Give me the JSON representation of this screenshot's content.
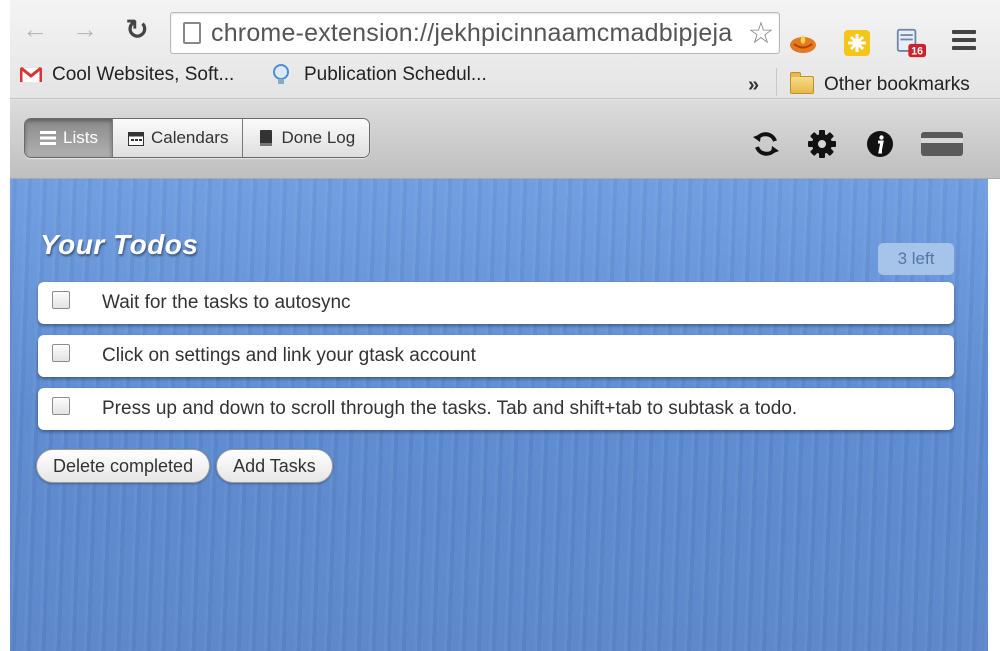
{
  "browser": {
    "url": "chrome-extension://jekhpicinnaamcmadbipjeja",
    "bookmarks": [
      {
        "label": "Cool Websites, Soft...",
        "icon": "gmail-icon"
      },
      {
        "label": "Publication Schedul...",
        "icon": "lightbulb-icon"
      }
    ],
    "more_label": "»",
    "other_bookmarks": "Other bookmarks",
    "extension_badge": "16"
  },
  "toolbar": {
    "tabs": [
      {
        "label": "Lists",
        "icon": "list-icon",
        "active": true
      },
      {
        "label": "Calendars",
        "icon": "calendar-icon",
        "active": false
      },
      {
        "label": "Done Log",
        "icon": "book-icon",
        "active": false
      }
    ],
    "icons": [
      "sync-icon",
      "gear-icon",
      "info-icon",
      "card-icon"
    ]
  },
  "main": {
    "title": "Your Todos",
    "left_count": "3 left",
    "todos": [
      {
        "text": "Wait for the tasks to autosync",
        "done": false
      },
      {
        "text": "Click on settings and link your gtask account",
        "done": false
      },
      {
        "text": "Press up and down to scroll through the tasks. Tab and shift+tab to subtask a todo.",
        "done": false
      }
    ],
    "actions": {
      "delete_completed": "Delete completed",
      "add_tasks": "Add Tasks"
    }
  },
  "colors": {
    "background_blue": "#5d8bd0",
    "badge_bg": "#a6c3ea",
    "active_tab": "#9a9a9a"
  }
}
